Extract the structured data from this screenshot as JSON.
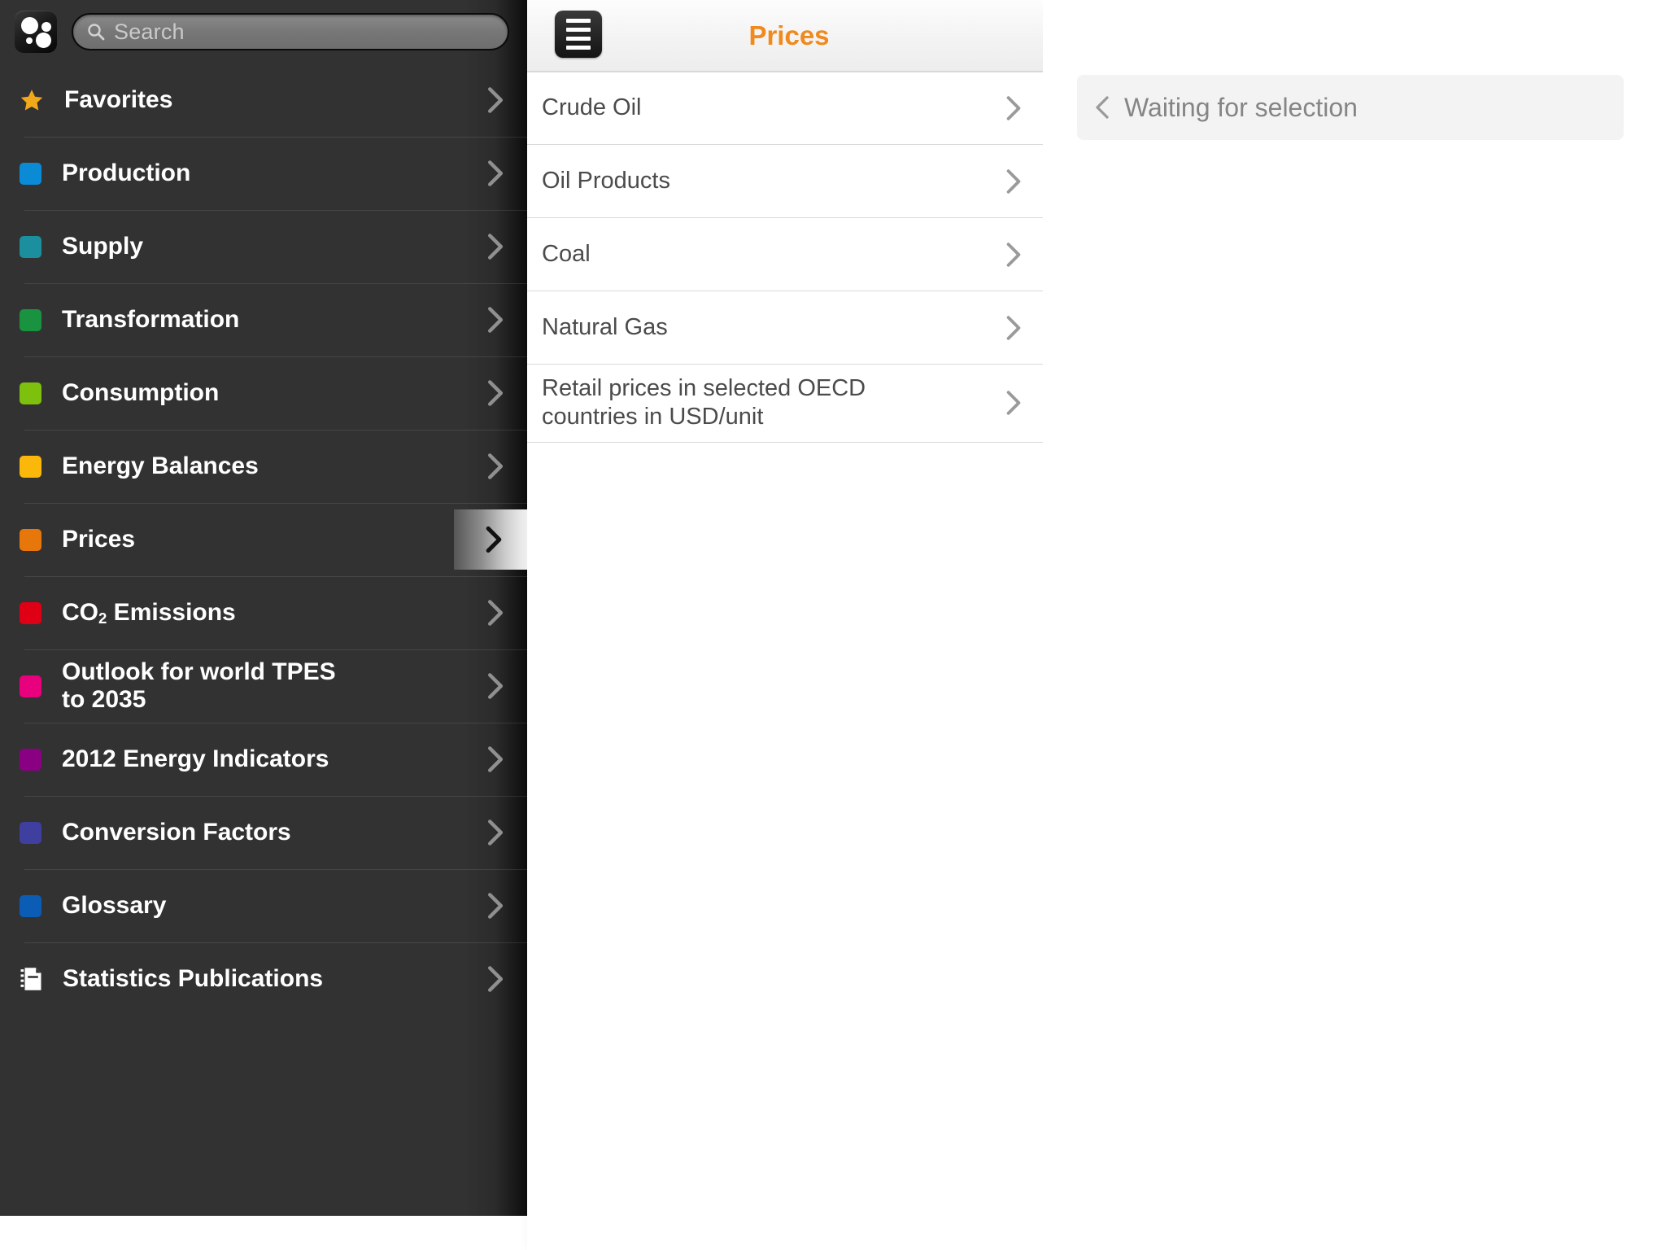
{
  "sidebar": {
    "logo_name": "app-logo",
    "search": {
      "placeholder": "Search",
      "value": "",
      "icon": "search-icon"
    },
    "items": [
      {
        "label": "Favorites",
        "icon": "star-icon",
        "color": "#f2a81b",
        "type": "star"
      },
      {
        "label": "Production",
        "icon": "color-swatch",
        "color": "#0b8bd6",
        "type": "swatch"
      },
      {
        "label": "Supply",
        "icon": "color-swatch",
        "color": "#1b8f9e",
        "type": "swatch"
      },
      {
        "label": "Transformation",
        "icon": "color-swatch",
        "color": "#1a9340",
        "type": "swatch"
      },
      {
        "label": "Consumption",
        "icon": "color-swatch",
        "color": "#7dc00e",
        "type": "swatch"
      },
      {
        "label": "Energy Balances",
        "icon": "color-swatch",
        "color": "#fcb70b",
        "type": "swatch"
      },
      {
        "label": "Prices",
        "icon": "color-swatch",
        "color": "#e8770b",
        "type": "swatch",
        "selected": true
      },
      {
        "label": "CO2 Emissions",
        "icon": "color-swatch",
        "color": "#e00016",
        "type": "swatch",
        "html": "CO<sub>2</sub> Emissions"
      },
      {
        "label": "Outlook for world TPES to 2035",
        "icon": "color-swatch",
        "color": "#e8007d",
        "type": "swatch"
      },
      {
        "label": "2012 Energy Indicators",
        "icon": "color-swatch",
        "color": "#8a0082",
        "type": "swatch"
      },
      {
        "label": "Conversion Factors",
        "icon": "color-swatch",
        "color": "#3f3fa0",
        "type": "swatch"
      },
      {
        "label": "Glossary",
        "icon": "color-swatch",
        "color": "#0b5cb5",
        "type": "swatch"
      },
      {
        "label": "Statistics Publications",
        "icon": "document-icon",
        "color": "#ffffff",
        "type": "doc",
        "divider_above": true
      }
    ],
    "chevron_icon": "chevron-right-icon"
  },
  "middle_panel": {
    "menu_button_icon": "hamburger-menu-icon",
    "title": "Prices",
    "title_color": "#f08a1e",
    "items": [
      {
        "label": "Crude Oil"
      },
      {
        "label": "Oil Products"
      },
      {
        "label": "Coal"
      },
      {
        "label": "Natural Gas"
      },
      {
        "label": "Retail prices in selected OECD countries in USD/unit"
      }
    ],
    "chevron_icon": "chevron-right-icon"
  },
  "right_panel": {
    "back_icon": "chevron-left-icon",
    "status_text": "Waiting for selection"
  }
}
